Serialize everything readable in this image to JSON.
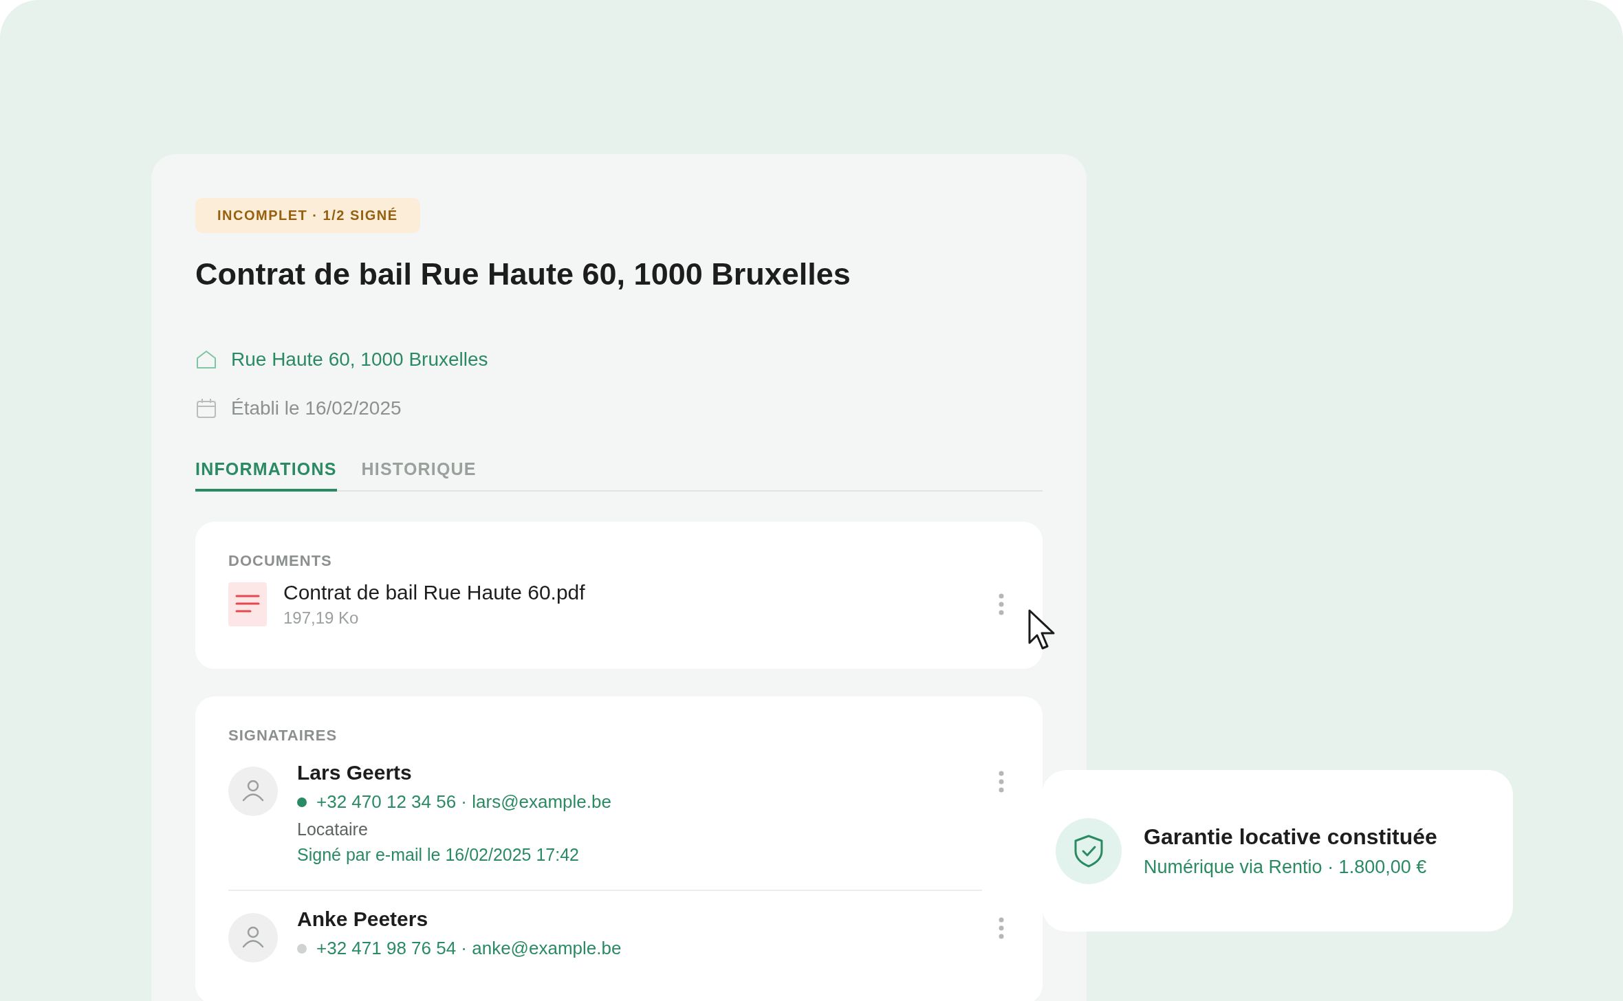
{
  "status_badge": "INCOMPLET · 1/2 SIGNÉ",
  "title": "Contrat de bail Rue Haute 60, 1000 Bruxelles",
  "address": "Rue Haute 60, 1000 Bruxelles",
  "established": "Établi le 16/02/2025",
  "tabs": [
    {
      "label": "INFORMATIONS",
      "selected": true
    },
    {
      "label": "HISTORIQUE",
      "selected": false
    }
  ],
  "documents": {
    "heading": "DOCUMENTS",
    "files": [
      {
        "name": "Contrat de bail Rue Haute 60.pdf",
        "size": "197,19 Ko"
      }
    ]
  },
  "signatories": {
    "heading": "SIGNATAIRES",
    "people": [
      {
        "name": "Lars Geerts",
        "contact": "+32 470 12 34 56 · lars@example.be",
        "signed": true,
        "role": "Locataire",
        "note": "Signé par e-mail le 16/02/2025 17:42"
      },
      {
        "name": "Anke Peeters",
        "contact": "+32 471 98 76 54 · anke@example.be",
        "signed": false
      }
    ]
  },
  "guarantee": {
    "title": "Garantie locative constituée",
    "detail": "Numérique via Rentio · 1.800,00 €"
  }
}
